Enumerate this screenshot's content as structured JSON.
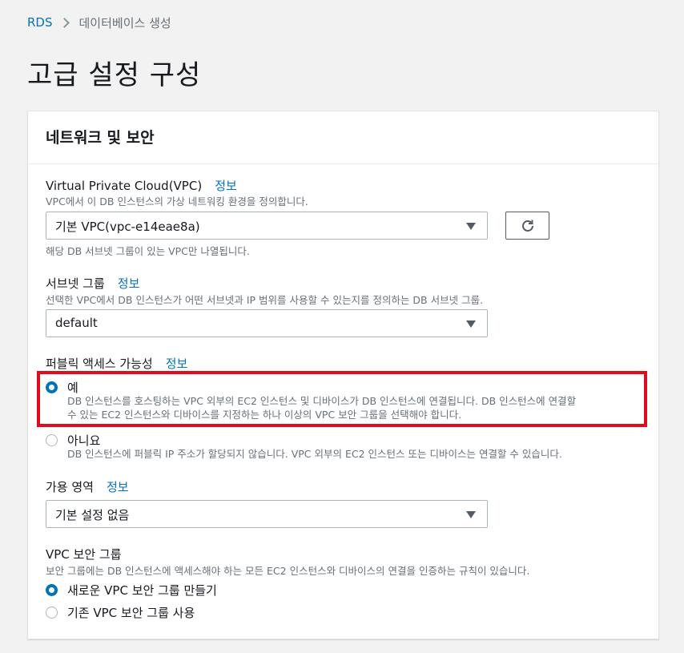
{
  "breadcrumb": {
    "root": "RDS",
    "current": "데이터베이스 생성"
  },
  "page_title": "고급 설정 구성",
  "panel": {
    "title": "네트워크 및 보안",
    "vpc": {
      "label": "Virtual Private Cloud(VPC)",
      "info": "정보",
      "description": "VPC에서 이 DB 인스턴스의 가상 네트워킹 환경을 정의합니다.",
      "value": "기본 VPC(vpc-e14eae8a)",
      "hint": "해당 DB 서브넷 그룹이 있는 VPC만 나열됩니다."
    },
    "subnet": {
      "label": "서브넷 그룹",
      "info": "정보",
      "description": "선택한 VPC에서 DB 인스턴스가 어떤 서브넷과 IP 범위를 사용할 수 있는지를 정의하는 DB 서브넷 그룹.",
      "value": "default"
    },
    "public_access": {
      "label": "퍼블릭 액세스 가능성",
      "info": "정보",
      "yes_label": "예",
      "yes_desc_line1": "DB 인스턴스를 호스팅하는 VPC 외부의 EC2 인스턴스 및 디바이스가 DB 인스턴스에 연결됩니다. DB 인스턴스에 연결할",
      "yes_desc_line2": "수 있는 EC2 인스턴스와 디바이스를 지정하는 하나 이상의 VPC 보안 그룹을 선택해야 합니다.",
      "no_label": "아니요",
      "no_desc": "DB 인스턴스에 퍼블릭 IP 주소가 할당되지 않습니다. VPC 외부의 EC2 인스턴스 또는 디바이스는 연결할 수 있습니다.",
      "selected": "yes"
    },
    "availability_zone": {
      "label": "가용 영역",
      "info": "정보",
      "value": "기본 설정 없음"
    },
    "security_group": {
      "label": "VPC 보안 그룹",
      "description": "보안 그룹에는 DB 인스턴스에 액세스해야 하는 모든 EC2 인스턴스와 디바이스의 연결을 인증하는 규칙이 있습니다.",
      "create_label": "새로운 VPC 보안 그룹 만들기",
      "existing_label": "기존 VPC 보안 그룹 사용",
      "selected": "create"
    }
  },
  "colors": {
    "accent": "#0073bb",
    "highlight": "#e00b1c"
  }
}
